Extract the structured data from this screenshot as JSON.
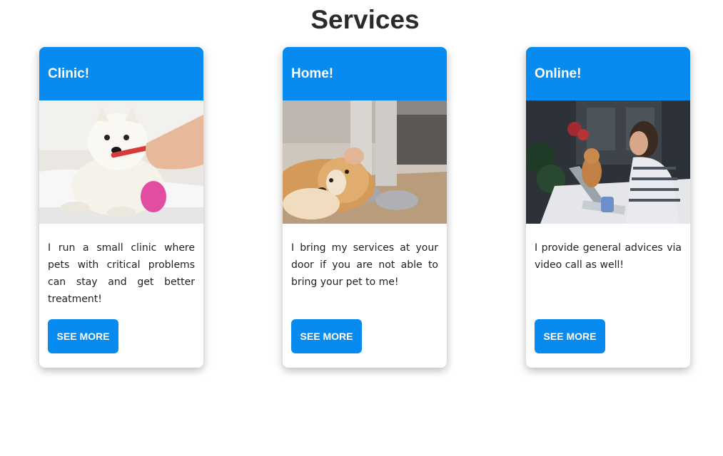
{
  "page": {
    "title": "Services"
  },
  "colors": {
    "accent": "#078bf0",
    "button_text": "#ffffff",
    "title_text": "#2b2b2b"
  },
  "cards": [
    {
      "title": "Clinic!",
      "image": "westie-dog-teeth-brushing-photo",
      "text": "I run a small clinic where pets with critical problems can stay and get better treatment!",
      "button_label": "SEE MORE"
    },
    {
      "title": "Home!",
      "image": "golden-retriever-at-owner-feet-photo",
      "text": "I bring my services at your door if you are not able to bring your pet to me!",
      "button_label": "SEE MORE"
    },
    {
      "title": "Online!",
      "image": "woman-video-call-with-cat-photo",
      "text": "I provide general advices via video call as well!",
      "button_label": "SEE MORE"
    }
  ]
}
